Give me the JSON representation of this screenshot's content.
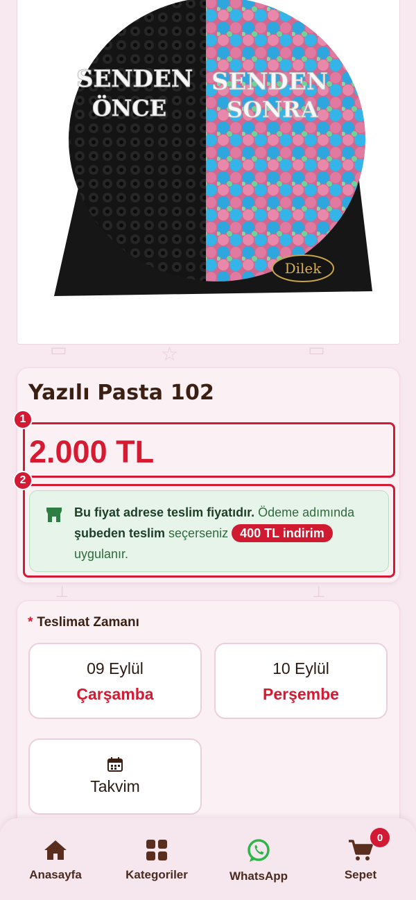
{
  "product": {
    "image_alt": "SENDEN ÖNCE SENDEN SONRA",
    "title": "Yazılı Pasta 102",
    "price": "2.000 TL",
    "image_texts": {
      "left_line1": "SENDEN",
      "left_line2": "ÖNCE",
      "right_line1": "SENDEN",
      "right_line2": "SONRA",
      "brand": "Dilek"
    }
  },
  "markers": [
    "1",
    "2"
  ],
  "notice": {
    "icon": "store-icon",
    "bold_part": "Bu fiyat adrese teslim fiyatıdır.",
    "text_1": " Ödeme adımında ",
    "bold_part_2": "şubeden teslim",
    "text_2": " seçerseniz ",
    "badge": "400 TL indirim",
    "text_3": " uygulanır."
  },
  "delivery": {
    "required_mark": "*",
    "label": "Teslimat Zamanı",
    "options": [
      {
        "date": "09 Eylül",
        "weekday": "Çarşamba"
      },
      {
        "date": "10 Eylül",
        "weekday": "Perşembe"
      }
    ],
    "calendar": {
      "icon": "calendar-icon",
      "label": "Takvim"
    }
  },
  "nav": {
    "items": [
      {
        "label": "Anasayfa",
        "icon": "home-icon"
      },
      {
        "label": "Kategoriler",
        "icon": "grid-icon"
      },
      {
        "label": "WhatsApp",
        "icon": "whatsapp-icon"
      },
      {
        "label": "Sepet",
        "icon": "cart-icon"
      }
    ],
    "cart_count": "0"
  },
  "colors": {
    "accent_red": "#d51a32",
    "brown": "#3a1f12",
    "background": "#f8e9f0",
    "notice_bg": "#e6f4ea",
    "whatsapp_green": "#2fb64a"
  }
}
